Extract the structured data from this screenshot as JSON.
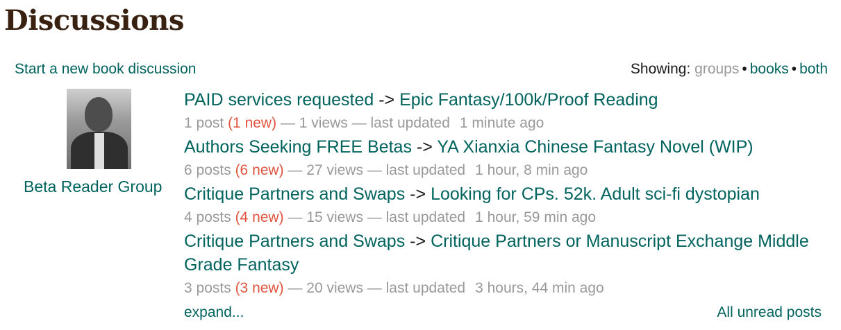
{
  "page": {
    "title": "Discussions",
    "start_link": "Start a new book discussion",
    "showing_label": "Showing:",
    "filters": [
      "groups",
      "books",
      "both"
    ],
    "filter_separator": "•"
  },
  "group": {
    "name": "Beta Reader Group",
    "avatar_icon": "group-avatar-photo"
  },
  "topics": [
    {
      "folder": "PAID services requested",
      "arrow": "->",
      "title": "Epic Fantasy/100k/Proof Reading",
      "posts": "1 post",
      "new": "(1 new)",
      "views": "— 1 views — last updated",
      "updated": "1 minute ago"
    },
    {
      "folder": "Authors Seeking FREE Betas",
      "arrow": "->",
      "title": "YA Xianxia Chinese Fantasy Novel (WIP)",
      "posts": "6 posts",
      "new": "(6 new)",
      "views": "— 27 views — last updated",
      "updated": "1 hour, 8 min ago"
    },
    {
      "folder": "Critique Partners and Swaps",
      "arrow": "->",
      "title": "Looking for CPs. 52k. Adult sci-fi dystopian",
      "posts": "4 posts",
      "new": "(4 new)",
      "views": "— 15 views — last updated",
      "updated": "1 hour, 59 min ago"
    },
    {
      "folder": "Critique Partners and Swaps",
      "arrow": "->",
      "title": "Critique Partners or Manuscript Exchange Middle Grade Fantasy",
      "posts": "3 posts",
      "new": "(3 new)",
      "views": "— 20 views — last updated",
      "updated": "3 hours, 44 min ago"
    }
  ],
  "footer": {
    "expand": "expand...",
    "all_unread": "All unread posts"
  },
  "colors": {
    "link": "#00635d",
    "title": "#382110",
    "new": "#e0533f",
    "muted": "#999999"
  }
}
